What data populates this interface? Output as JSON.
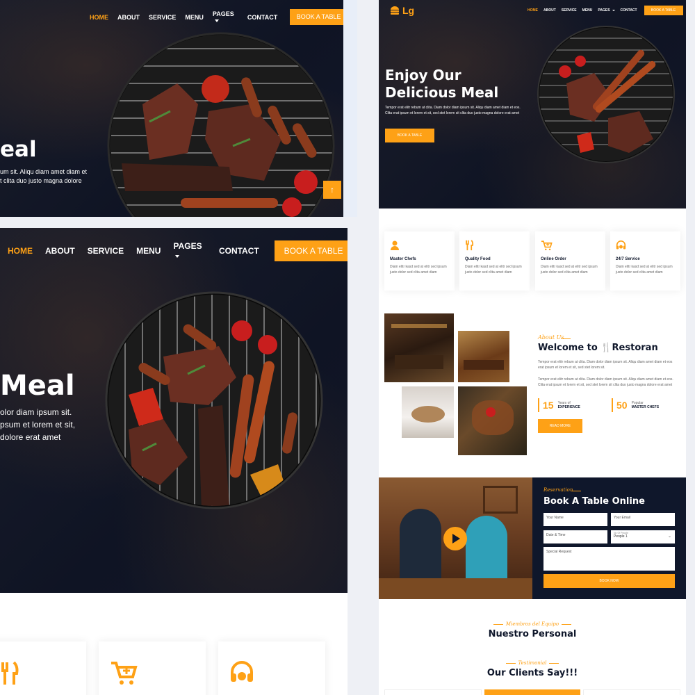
{
  "brand": {
    "name": "Lg"
  },
  "nav": {
    "items": [
      "HOME",
      "ABOUT",
      "SERVICE",
      "MENU",
      "PAGES",
      "CONTACT"
    ],
    "cta": "BOOK A TABLE"
  },
  "hero": {
    "title_line1": "Enjoy Our",
    "title_line2": "Delicious Meal",
    "crop_title_small": "eal",
    "crop_title_large": "Meal",
    "text": "Tempor erat elitr rebum at clita. Diam dolor diam ipsum sit. Aliqu diam amet diam et eos. Clita erat ipsum et lorem et sit, sed stet lorem sit clita duo justo magna dolore erat amet",
    "crop_small_line1": "um sit. Aliqu diam amet diam et",
    "crop_small_line2": "t clita duo justo magna dolore",
    "crop_large_line1": "olor diam ipsum sit.",
    "crop_large_line2": "psum et lorem et sit,",
    "crop_large_line3": "dolore erat amet",
    "button": "BOOK A TABLE"
  },
  "services": [
    {
      "title": "Master Chefs",
      "text": "Diam elitr kasd sed at elitr sed ipsum justo dolor sed clita amet diam",
      "icon": "chef-icon"
    },
    {
      "title": "Quality Food",
      "text": "Diam elitr kasd sed at elitr sed ipsum justo dolor sed clita amet diam",
      "icon": "utensils-icon"
    },
    {
      "title": "Online Order",
      "text": "Diam elitr kasd sed at elitr sed ipsum justo dolor sed clita amet diam",
      "icon": "cart-plus-icon"
    },
    {
      "title": "24/7 Service",
      "text": "Diam elitr kasd sed at elitr sed ipsum justo dolor sed clita amet diam",
      "icon": "headset-icon"
    }
  ],
  "about": {
    "kicker": "About Us",
    "title_prefix": "Welcome to",
    "title_brand": "Restoran",
    "para1": "Tempor erat elitr rebum at clita. Diam dolor diam ipsum sit. Aliqu diam amet diam et eos erat ipsum et lorem et sit, sed stet lorem sit.",
    "para2": "Tempor erat elitr rebum at clita. Diam dolor diam ipsum sit. Aliqu diam amet diam et eos. Clita erat ipsum et lorem et sit, sed stet lorem sit clita duo justo magna dolore erat amet",
    "stat1_value": "15",
    "stat1_label_top": "Years of",
    "stat1_label_bottom": "EXPERIENCE",
    "stat2_value": "50",
    "stat2_label_top": "Popular",
    "stat2_label_bottom": "MASTER CHEFS",
    "button": "READ MORE"
  },
  "reservation": {
    "kicker": "Reservation",
    "title": "Book A Table Online",
    "name_placeholder": "Your Name",
    "email_placeholder": "Your Email",
    "date_placeholder": "Date & Time",
    "people_label": "No Of People",
    "people_value": "People 1",
    "request_placeholder": "Special Request",
    "button": "BOOK NOW"
  },
  "team": {
    "kicker": "Miembros del Equipo",
    "title": "Nuestro Personal"
  },
  "testimonial": {
    "kicker": "Testimonial",
    "title": "Our Clients Say!!!"
  },
  "colors": {
    "accent": "#FEA116",
    "dark": "#0F172B"
  }
}
